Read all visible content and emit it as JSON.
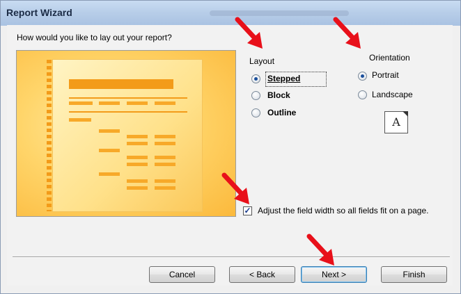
{
  "window": {
    "title": "Report Wizard"
  },
  "question": "How would you like to lay out your report?",
  "layout": {
    "label": "Layout",
    "options": [
      "Stepped",
      "Block",
      "Outline"
    ],
    "selected": "Stepped"
  },
  "orientation": {
    "label": "Orientation",
    "options": [
      "Portrait",
      "Landscape"
    ],
    "selected": "Portrait",
    "preview_letter": "A"
  },
  "adjust_width": {
    "checked": true,
    "label": "Adjust the field width so all fields fit on a page."
  },
  "buttons": {
    "cancel": "Cancel",
    "back": "< Back",
    "next": "Next >",
    "finish": "Finish"
  },
  "colors": {
    "annotation_arrow": "#e8101a",
    "preview_accent": "#f39b19",
    "titlebar": "#b7cde8"
  }
}
